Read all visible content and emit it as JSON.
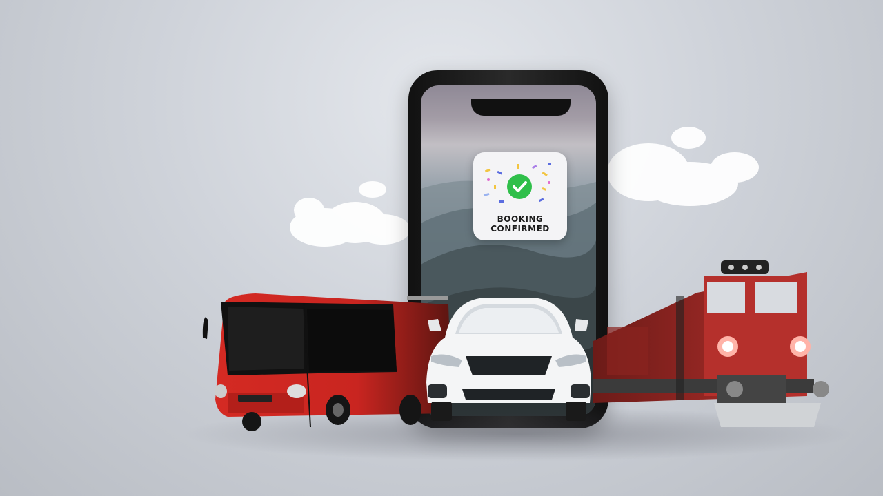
{
  "booking_badge": {
    "line1": "BOOKING",
    "line2": "CONFIRMED",
    "icon": "check-circle-icon",
    "accent_color": "#2fbf4a"
  },
  "vehicles": [
    "bus",
    "car",
    "train"
  ],
  "colors": {
    "bus_red": "#d42a23",
    "train_red": "#b5302c",
    "car_white": "#f4f5f6"
  }
}
